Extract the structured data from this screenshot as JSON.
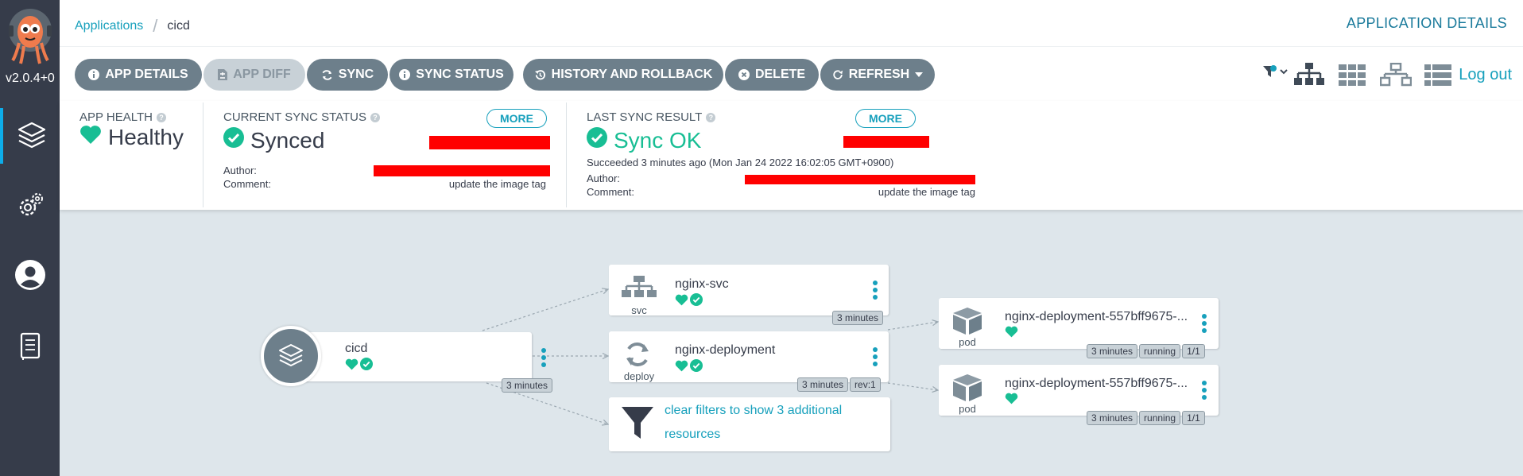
{
  "app": {
    "version": "v2.0.4+0"
  },
  "sidebar": {
    "items": [
      {
        "name": "applications",
        "icon": "layers-icon",
        "active": true
      },
      {
        "name": "settings",
        "icon": "gears-icon"
      },
      {
        "name": "user-info",
        "icon": "user-icon"
      },
      {
        "name": "docs",
        "icon": "book-icon"
      }
    ]
  },
  "breadcrumb": {
    "root": "Applications",
    "current": "cicd"
  },
  "page_label": "APPLICATION DETAILS",
  "toolbar": {
    "app_details": "APP DETAILS",
    "app_diff": "APP DIFF",
    "sync": "SYNC",
    "sync_status": "SYNC STATUS",
    "history": "HISTORY AND ROLLBACK",
    "delete": "DELETE",
    "refresh": "REFRESH",
    "logout": "Log out"
  },
  "status": {
    "health": {
      "title": "APP HEALTH",
      "value": "Healthy"
    },
    "current_sync": {
      "title": "CURRENT SYNC STATUS",
      "value": "Synced",
      "more": "MORE",
      "author_label": "Author:",
      "comment_label": "Comment:",
      "comment": "update the image tag"
    },
    "last_sync": {
      "title": "LAST SYNC RESULT",
      "value": "Sync OK",
      "more": "MORE",
      "succeeded": "Succeeded 3 minutes ago (Mon Jan 24 2022 16:02:05 GMT+0900)",
      "author_label": "Author:",
      "comment_label": "Comment:",
      "comment": "update the image tag"
    }
  },
  "colors": {
    "sidebar": "#363c4a",
    "accent": "#17a0bc",
    "healthy": "#18be94",
    "button": "#6d7f8b",
    "redaction": "#ff0000"
  },
  "graph": {
    "root": {
      "name": "cicd",
      "age": "3 minutes"
    },
    "svc": {
      "kind": "svc",
      "name": "nginx-svc",
      "age": "3 minutes"
    },
    "deploy": {
      "kind": "deploy",
      "name": "nginx-deployment",
      "age": "3 minutes",
      "rev": "rev:1"
    },
    "filter": {
      "text": "clear filters to show 3 additional resources"
    },
    "pods": [
      {
        "kind": "pod",
        "name": "nginx-deployment-557bff9675-...",
        "age": "3 minutes",
        "state": "running",
        "ready": "1/1"
      },
      {
        "kind": "pod",
        "name": "nginx-deployment-557bff9675-...",
        "age": "3 minutes",
        "state": "running",
        "ready": "1/1"
      }
    ]
  }
}
